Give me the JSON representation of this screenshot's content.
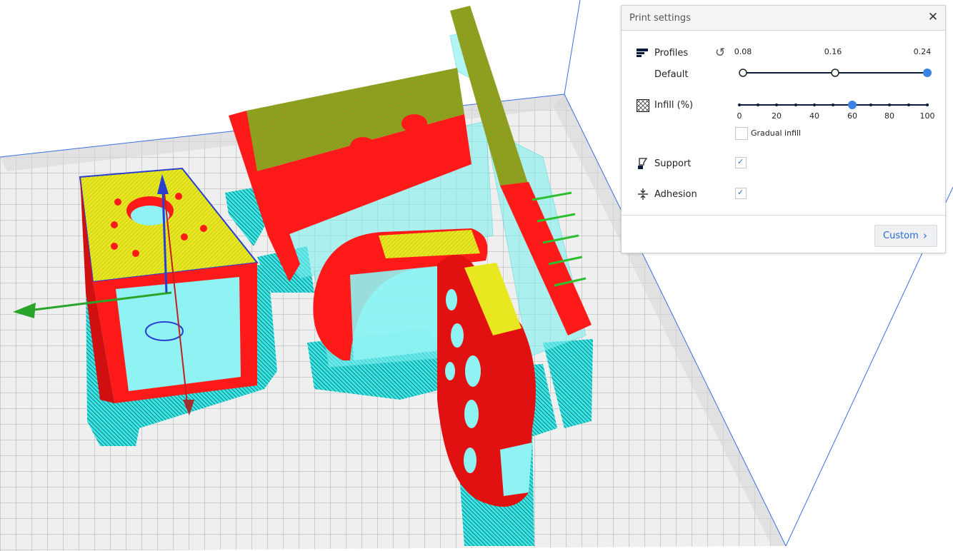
{
  "panel": {
    "title": "Print settings",
    "close_icon": "close-icon"
  },
  "profiles": {
    "label": "Profiles",
    "value_label": "Default",
    "reset_icon": "reset-icon",
    "ticks": [
      "0.08",
      "0.16",
      "0.24"
    ],
    "selected": "0.24"
  },
  "infill": {
    "label": "Infill (%)",
    "ticks": [
      "0",
      "20",
      "40",
      "60",
      "80",
      "100"
    ],
    "value": 60,
    "gradual_label": "Gradual infill",
    "gradual_checked": false
  },
  "support": {
    "label": "Support",
    "checked": true
  },
  "adhesion": {
    "label": "Adhesion",
    "checked": true
  },
  "custom_button": {
    "label": "Custom"
  },
  "colors": {
    "accent": "#2a6cd6",
    "outer_wall": "#ff1a1a",
    "top_skin": "#e8e820",
    "support": "#39e6e6",
    "infill": "#ffb000",
    "x_axis": "#2aa52a",
    "y_axis": "#c02020",
    "z_axis": "#2a3fd0"
  }
}
